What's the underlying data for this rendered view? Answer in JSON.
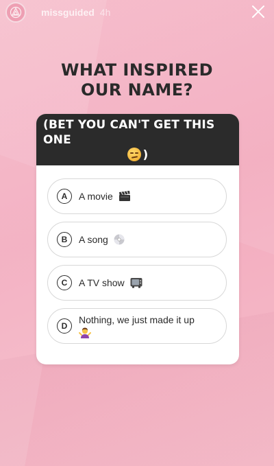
{
  "story": {
    "username": "missguided",
    "time": "4h"
  },
  "question": {
    "line1": "WHAT INSPIRED",
    "line2": "OUR NAME?"
  },
  "quiz": {
    "prompt_line1": "(BET YOU CAN'T GET THIS ONE",
    "prompt_line2_end": ")",
    "options": [
      {
        "letter": "A",
        "text": "A movie",
        "emoji": "clapper-board-icon"
      },
      {
        "letter": "B",
        "text": "A song",
        "emoji": "dvd-disc-icon"
      },
      {
        "letter": "C",
        "text": "A TV show",
        "emoji": "television-icon"
      },
      {
        "letter": "D",
        "text": "Nothing, we just made it up",
        "emoji": "woman-shrugging-icon"
      }
    ]
  },
  "colors": {
    "background": "#f2aabd",
    "card_header": "#2b2b2b",
    "card": "#ffffff"
  }
}
